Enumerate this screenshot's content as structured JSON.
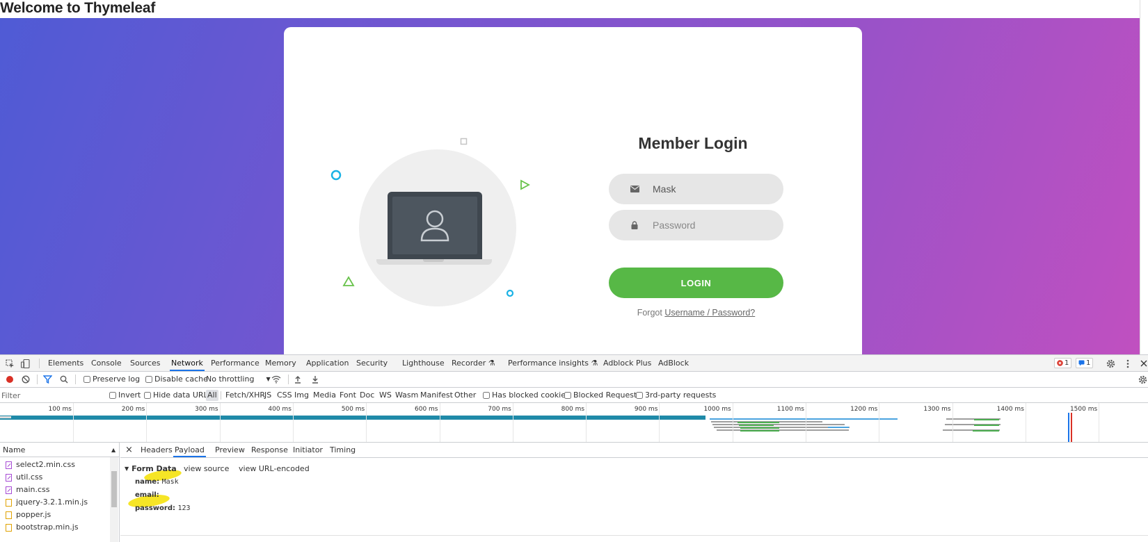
{
  "page": {
    "heading": "Welcome to Thymeleaf"
  },
  "login": {
    "title": "Member Login",
    "email_value": "Mask",
    "password_placeholder": "Password",
    "button_label": "LOGIN",
    "forgot_prefix": "Forgot",
    "forgot_link": "Username / Password?",
    "button_color": "#57b846"
  },
  "devtools": {
    "tabs": [
      "Elements",
      "Console",
      "Sources",
      "Network",
      "Performance",
      "Memory",
      "Application",
      "Security",
      "Lighthouse",
      "Recorder",
      "Performance insights",
      "Adblock Plus",
      "AdBlock"
    ],
    "active_tab": "Network",
    "error_count": "1",
    "message_count": "1",
    "toolbar": {
      "preserve_log": "Preserve log",
      "disable_cache": "Disable cache",
      "throttling": "No throttling"
    },
    "filter": {
      "placeholder": "Filter",
      "invert": "Invert",
      "hide_data_urls": "Hide data URLs",
      "types": [
        "All",
        "Fetch/XHR",
        "JS",
        "CSS",
        "Img",
        "Media",
        "Font",
        "Doc",
        "WS",
        "Wasm",
        "Manifest",
        "Other"
      ],
      "has_blocked_cookies": "Has blocked cookies",
      "blocked_requests": "Blocked Requests",
      "third_party": "3rd-party requests"
    },
    "timeline_ticks": [
      "100 ms",
      "200 ms",
      "300 ms",
      "400 ms",
      "500 ms",
      "600 ms",
      "700 ms",
      "800 ms",
      "900 ms",
      "1000 ms",
      "1100 ms",
      "1200 ms",
      "1300 ms",
      "1400 ms",
      "1500 ms"
    ],
    "names_header": "Name",
    "files": [
      {
        "name": "select2.min.css",
        "type": "css"
      },
      {
        "name": "util.css",
        "type": "css"
      },
      {
        "name": "main.css",
        "type": "css"
      },
      {
        "name": "jquery-3.2.1.min.js",
        "type": "js"
      },
      {
        "name": "popper.js",
        "type": "js"
      },
      {
        "name": "bootstrap.min.js",
        "type": "js"
      }
    ],
    "detail_tabs": [
      "Headers",
      "Payload",
      "Preview",
      "Response",
      "Initiator",
      "Timing"
    ],
    "active_detail_tab": "Payload",
    "form_data": {
      "title": "Form Data",
      "view_source": "view source",
      "view_url_encoded": "view URL-encoded",
      "rows": [
        {
          "key": "name:",
          "value": "Mask"
        },
        {
          "key": "email:",
          "value": ""
        },
        {
          "key": "password:",
          "value": "123"
        }
      ]
    }
  }
}
